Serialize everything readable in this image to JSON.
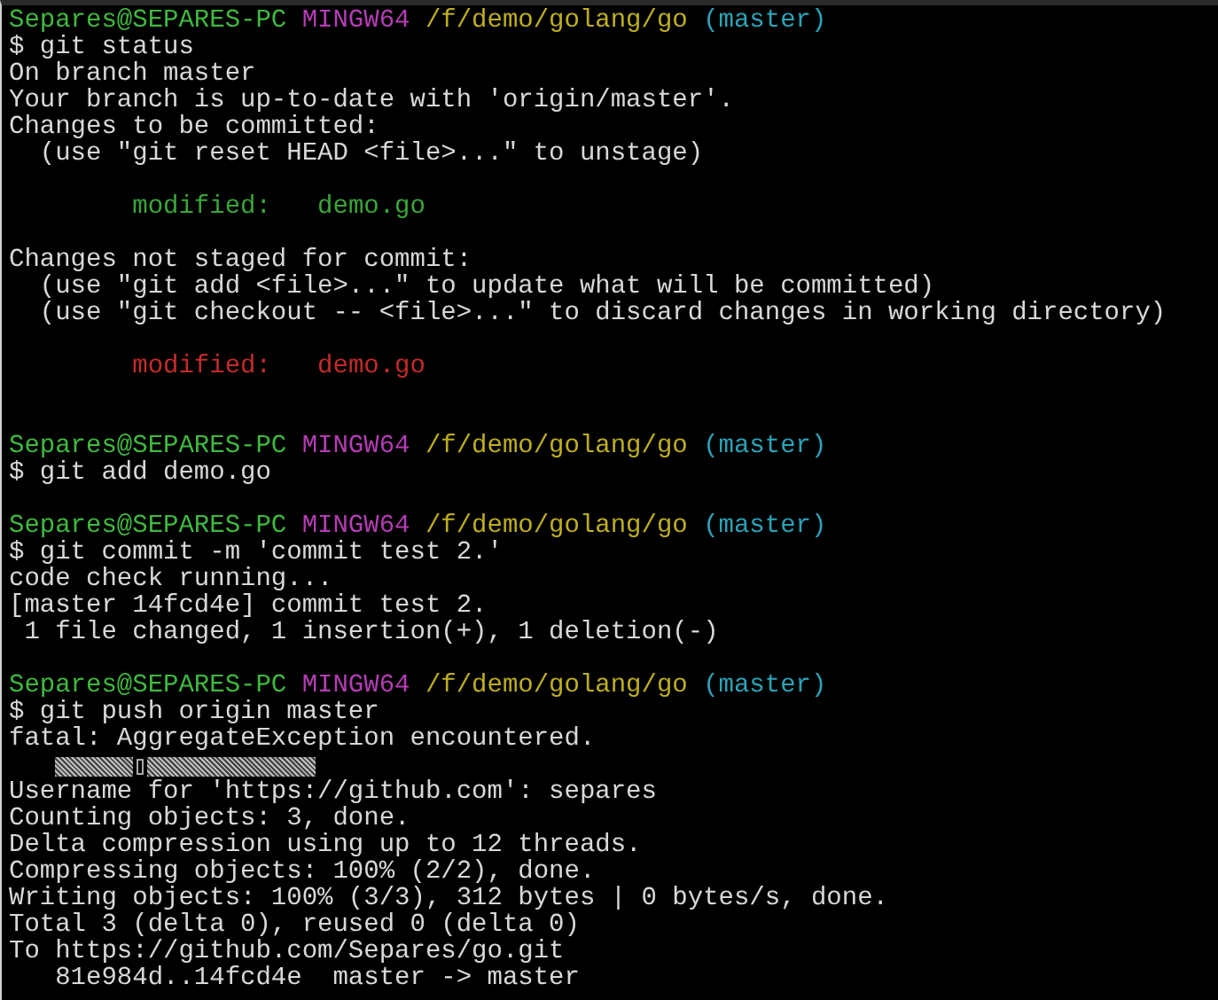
{
  "terminal": {
    "lines": [
      {
        "kind": "prompt",
        "user": "Separes@SEPARES-PC",
        "shell": "MINGW64",
        "path": "/f/demo/golang/go",
        "branch": "(master)"
      },
      {
        "kind": "command",
        "text": "$ git status"
      },
      {
        "kind": "output",
        "text": "On branch master"
      },
      {
        "kind": "output",
        "text": "Your branch is up-to-date with 'origin/master'."
      },
      {
        "kind": "output",
        "text": "Changes to be committed:"
      },
      {
        "kind": "output",
        "text": "  (use \"git reset HEAD <file>...\" to unstage)"
      },
      {
        "kind": "blank"
      },
      {
        "kind": "staged",
        "label": "        modified:",
        "file": "   demo.go"
      },
      {
        "kind": "blank"
      },
      {
        "kind": "output",
        "text": "Changes not staged for commit:"
      },
      {
        "kind": "output",
        "text": "  (use \"git add <file>...\" to update what will be committed)"
      },
      {
        "kind": "output",
        "text": "  (use \"git checkout -- <file>...\" to discard changes in working directory)"
      },
      {
        "kind": "blank"
      },
      {
        "kind": "unstaged",
        "label": "        modified:",
        "file": "   demo.go"
      },
      {
        "kind": "blank"
      },
      {
        "kind": "blank"
      },
      {
        "kind": "prompt",
        "user": "Separes@SEPARES-PC",
        "shell": "MINGW64",
        "path": "/f/demo/golang/go",
        "branch": "(master)"
      },
      {
        "kind": "command",
        "text": "$ git add demo.go"
      },
      {
        "kind": "blank"
      },
      {
        "kind": "prompt",
        "user": "Separes@SEPARES-PC",
        "shell": "MINGW64",
        "path": "/f/demo/golang/go",
        "branch": "(master)"
      },
      {
        "kind": "command",
        "text": "$ git commit -m 'commit test 2.'"
      },
      {
        "kind": "output",
        "text": "code check running..."
      },
      {
        "kind": "output",
        "text": "[master 14fcd4e] commit test 2."
      },
      {
        "kind": "output",
        "text": " 1 file changed, 1 insertion(+), 1 deletion(-)"
      },
      {
        "kind": "blank"
      },
      {
        "kind": "prompt",
        "user": "Separes@SEPARES-PC",
        "shell": "MINGW64",
        "path": "/f/demo/golang/go",
        "branch": "(master)"
      },
      {
        "kind": "command",
        "text": "$ git push origin master"
      },
      {
        "kind": "output",
        "text": "fatal: AggregateException encountered."
      },
      {
        "kind": "garbled"
      },
      {
        "kind": "output",
        "text": "Username for 'https://github.com': separes"
      },
      {
        "kind": "output",
        "text": "Counting objects: 3, done."
      },
      {
        "kind": "output",
        "text": "Delta compression using up to 12 threads."
      },
      {
        "kind": "output",
        "text": "Compressing objects: 100% (2/2), done."
      },
      {
        "kind": "output",
        "text": "Writing objects: 100% (3/3), 312 bytes | 0 bytes/s, done."
      },
      {
        "kind": "output",
        "text": "Total 3 (delta 0), reused 0 (delta 0)"
      },
      {
        "kind": "output",
        "text": "To https://github.com/Separes/go.git"
      },
      {
        "kind": "output",
        "text": "   81e984d..14fcd4e  master -> master"
      }
    ]
  }
}
